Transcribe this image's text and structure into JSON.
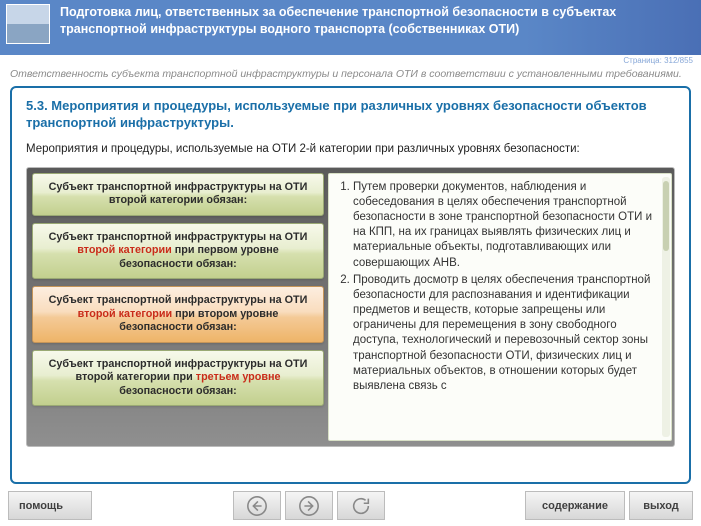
{
  "header": {
    "title": "Подготовка лиц, ответственных за обеспечение транспортной безопасности в субъектах транспортной инфраструктуры водного транспорта (собственниках ОТИ)"
  },
  "page_counter": "Страница: 312/855",
  "subtitle": "Ответственность субъекта транспортной инфраструктуры и персонала ОТИ в соответствии с установленными требованиями.",
  "section_title": "5.3. Мероприятия и процедуры, используемые при различных уровнях безопасности объектов транспортной инфраструктуры.",
  "intro_text": "Мероприятия и процедуры, используемые на ОТИ 2-й категории при различных уровнях безопасности:",
  "tabs": [
    {
      "pre": "Субъект транспортной инфраструктуры на ОТИ второй категории обязан:"
    },
    {
      "pre": "Субъект транспортной инфраструктуры на ОТИ ",
      "hl": "второй категории",
      "post": " при первом уровне безопасности обязан:"
    },
    {
      "pre": "Субъект транспортной инфраструктуры на ОТИ ",
      "hl": "второй категории",
      "post": " при втором уровне безопасности обязан:"
    },
    {
      "pre": "Субъект транспортной инфраструктуры на ОТИ второй категории при ",
      "hl": "третьем уровне",
      "post": " безопасности обязан:"
    }
  ],
  "right": {
    "item1": "Путем проверки документов, наблюдения и собеседования в целях обеспечения транспортной безопасности в зоне транспортной безопасности ОТИ и на КПП, на их границах выявлять физических лиц и материальные объекты, подготавливающих или совершающих АНВ.",
    "item2": "Проводить досмотр в целях обеспечения транспортной безопасности для распознавания и идентификации предметов и веществ, которые запрещены или ограничены для перемещения в зону свободного доступа, технологический и перевозочный сектор зоны транспортной безопасности ОТИ, физических лиц и материальных объектов, в отношении которых будет выявлена связь с"
  },
  "footer": {
    "help": "помощь",
    "toc": "содержание",
    "exit": "выход"
  }
}
